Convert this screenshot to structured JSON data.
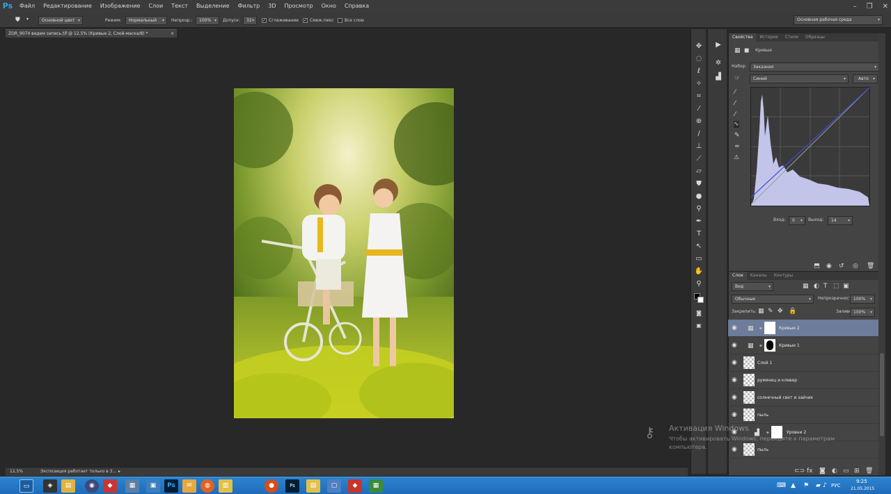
{
  "app": {
    "logo": "Ps"
  },
  "menu": [
    "Файл",
    "Редактирование",
    "Изображение",
    "Слои",
    "Текст",
    "Выделение",
    "Фильтр",
    "3D",
    "Просмотр",
    "Окно",
    "Справка"
  ],
  "options": {
    "tool_preset": "Основной цвет",
    "mode_label": "Режим:",
    "mode_value": "Нормальный",
    "opacity_label": "Непрозр.:",
    "opacity_value": "100%",
    "tolerance_label": "Допуск:",
    "tolerance_value": "32",
    "antialias": "Сглаживание",
    "contiguous": "Смеж.пикс",
    "all_layers": "Все слои",
    "workspace": "Основная рабочая среда"
  },
  "document": {
    "tab_title": "ZOR_9074 ведем запись.tif @ 12,5% (Кривые 2, Слой-маска/8) *"
  },
  "status": {
    "zoom": "12,5%",
    "message": "Экспозиция работает только в 3..."
  },
  "properties": {
    "tabs": [
      "Свойства",
      "История",
      "Стили",
      "Образцы"
    ],
    "adj_title": "Кривые",
    "preset_label": "Набор:",
    "preset_value": "Заказная",
    "channel_value": "Синий",
    "auto_button": "Авто",
    "input_label": "Вход:",
    "input_value": "0",
    "output_label": "Выход:",
    "output_value": "14"
  },
  "layers": {
    "tabs": [
      "Слои",
      "Каналы",
      "Контуры"
    ],
    "filter_kind": "Вид",
    "blend_mode": "Обычные",
    "opacity_label": "Непрозрачность:",
    "opacity_value": "100%",
    "lock_label": "Закрепить:",
    "fill_label": "Заливка:",
    "fill_value": "100%",
    "items": [
      {
        "name": "Кривые 2"
      },
      {
        "name": "Кривые 1"
      },
      {
        "name": "Слой 1"
      },
      {
        "name": "румянец и клевер"
      },
      {
        "name": "солнечный свет и зайчик"
      },
      {
        "name": "пыль"
      },
      {
        "name": "Уровни 2"
      },
      {
        "name": "пыль"
      }
    ]
  },
  "watermark": {
    "title": "Активация Windows",
    "line1": "Чтобы активировать Windows, перейдите к параметрам",
    "line2": "компьютера."
  },
  "taskbar": {
    "lang": "РУС",
    "time": "9:25",
    "date": "21.05.2015"
  },
  "colors": {
    "photoshop_blue": "#35a5e8",
    "selection": "#6c7c9a",
    "taskbar": "#1f6cb8"
  }
}
